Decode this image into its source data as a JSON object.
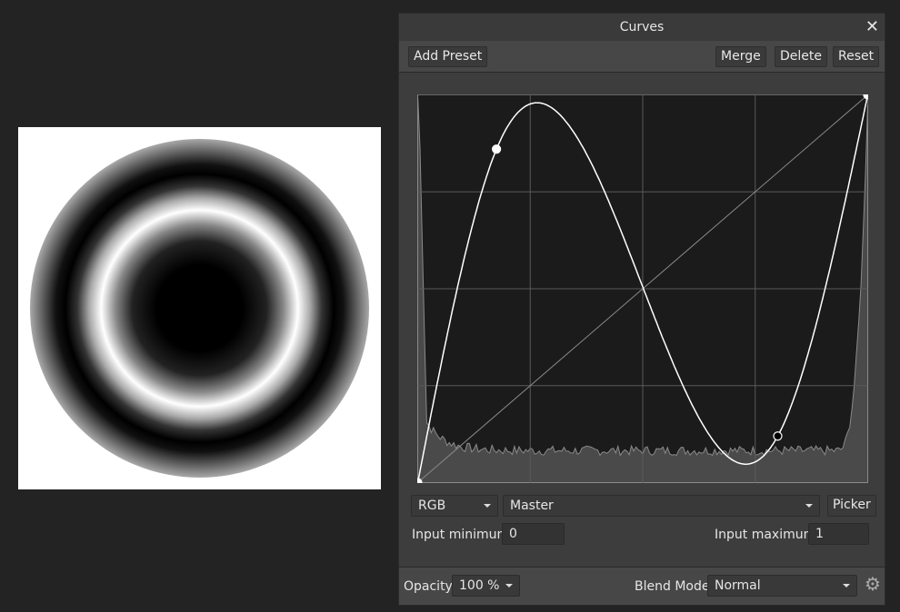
{
  "panel": {
    "title": "Curves",
    "close_icon": "close-icon"
  },
  "toolbar": {
    "add_preset": "Add Preset",
    "merge": "Merge",
    "delete": "Delete",
    "reset": "Reset"
  },
  "curve": {
    "points": [
      [
        0,
        0
      ],
      [
        0.175,
        0.86
      ],
      [
        0.8,
        0.12
      ],
      [
        1,
        1
      ]
    ]
  },
  "controls": {
    "channel_mode": "RGB",
    "channel": "Master",
    "picker": "Picker",
    "input_min_label": "Input minimum:",
    "input_min": "0",
    "input_max_label": "Input maximum:",
    "input_max": "1"
  },
  "footer": {
    "opacity_label": "Opacity:",
    "opacity": "100 %",
    "blend_label": "Blend Mode:",
    "blend": "Normal",
    "settings_icon": "gear-icon"
  }
}
